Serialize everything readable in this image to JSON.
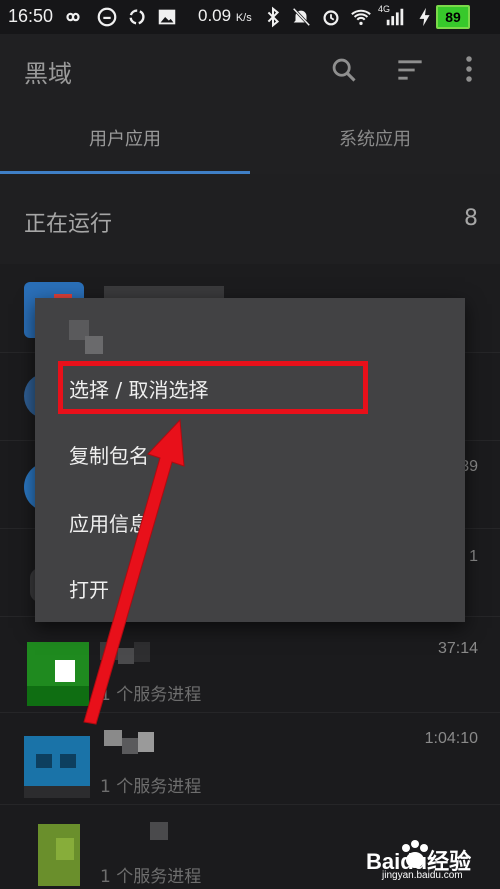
{
  "status_bar": {
    "time": "16:50",
    "speed_value": "0.09",
    "speed_unit": "K/s",
    "battery": "89",
    "signal_label": "4G"
  },
  "app_bar": {
    "title": "黑域",
    "icons": [
      "search-icon",
      "sort-icon",
      "more-icon"
    ]
  },
  "tabs": [
    {
      "label": "用户应用",
      "active": true
    },
    {
      "label": "系统应用",
      "active": false
    }
  ],
  "section": {
    "label": "正在运行",
    "count": "8"
  },
  "rows": [
    {
      "subtitle": "1 个服务进程",
      "time": "37:14"
    },
    {
      "subtitle": "1 个服务进程",
      "time": "1:04:10"
    },
    {
      "subtitle": "1 个服务进程",
      "time": ""
    }
  ],
  "partial_times": [
    "39",
    "1"
  ],
  "context_menu": {
    "items": [
      "选择 / 取消选择",
      "复制包名",
      "应用信息",
      "打开"
    ]
  },
  "watermark": {
    "brand": "Baidu经验",
    "site": "jingyan.baidu.com"
  },
  "colors": {
    "accent_tab": "#3f7fc6",
    "highlight_box": "#e8101a",
    "battery": "#37c92b"
  }
}
